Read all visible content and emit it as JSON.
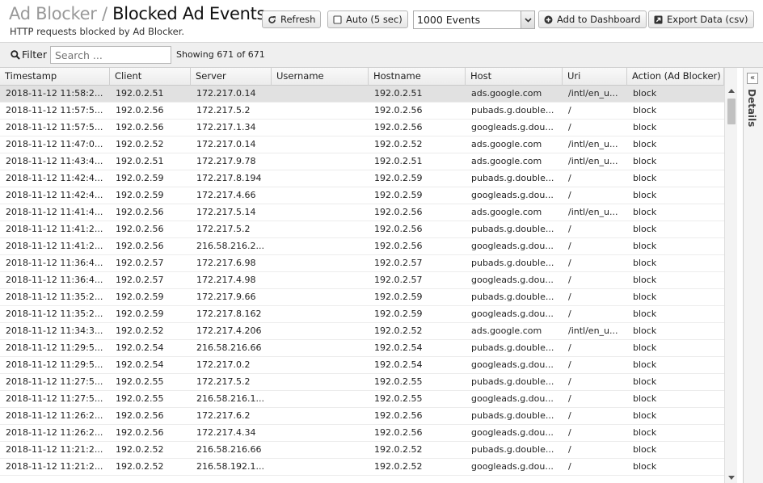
{
  "header": {
    "breadcrumb": "Ad Blocker",
    "separator": "/",
    "title": "Blocked Ad Events",
    "subtitle": "HTTP requests blocked by Ad Blocker."
  },
  "toolbar": {
    "refresh_label": "Refresh",
    "auto_label": "Auto (5 sec)",
    "auto_checked": false,
    "events_selected": "1000 Events",
    "add_dashboard_label": "Add to Dashboard",
    "export_label": "Export Data (csv)"
  },
  "filter": {
    "label": "Filter",
    "placeholder": "Search ...",
    "showing": "Showing 671 of 671"
  },
  "details": {
    "label": "Details",
    "collapse_glyph": "«"
  },
  "grid": {
    "columns": [
      "Timestamp",
      "Client",
      "Server",
      "Username",
      "Hostname",
      "Host",
      "Uri",
      "Action (Ad Blocker)"
    ],
    "rows": [
      [
        "2018-11-12 11:58:2...",
        "192.0.2.51",
        "172.217.0.14",
        "",
        "192.0.2.51",
        "ads.google.com",
        "/intl/en_u...",
        "block"
      ],
      [
        "2018-11-12 11:57:5...",
        "192.0.2.56",
        "172.217.5.2",
        "",
        "192.0.2.56",
        "pubads.g.double...",
        "/",
        "block"
      ],
      [
        "2018-11-12 11:57:5...",
        "192.0.2.56",
        "172.217.1.34",
        "",
        "192.0.2.56",
        "googleads.g.dou...",
        "/",
        "block"
      ],
      [
        "2018-11-12 11:47:0...",
        "192.0.2.52",
        "172.217.0.14",
        "",
        "192.0.2.52",
        "ads.google.com",
        "/intl/en_u...",
        "block"
      ],
      [
        "2018-11-12 11:43:4...",
        "192.0.2.51",
        "172.217.9.78",
        "",
        "192.0.2.51",
        "ads.google.com",
        "/intl/en_u...",
        "block"
      ],
      [
        "2018-11-12 11:42:4...",
        "192.0.2.59",
        "172.217.8.194",
        "",
        "192.0.2.59",
        "pubads.g.double...",
        "/",
        "block"
      ],
      [
        "2018-11-12 11:42:4...",
        "192.0.2.59",
        "172.217.4.66",
        "",
        "192.0.2.59",
        "googleads.g.dou...",
        "/",
        "block"
      ],
      [
        "2018-11-12 11:41:4...",
        "192.0.2.56",
        "172.217.5.14",
        "",
        "192.0.2.56",
        "ads.google.com",
        "/intl/en_u...",
        "block"
      ],
      [
        "2018-11-12 11:41:2...",
        "192.0.2.56",
        "172.217.5.2",
        "",
        "192.0.2.56",
        "pubads.g.double...",
        "/",
        "block"
      ],
      [
        "2018-11-12 11:41:2...",
        "192.0.2.56",
        "216.58.216.2...",
        "",
        "192.0.2.56",
        "googleads.g.dou...",
        "/",
        "block"
      ],
      [
        "2018-11-12 11:36:4...",
        "192.0.2.57",
        "172.217.6.98",
        "",
        "192.0.2.57",
        "pubads.g.double...",
        "/",
        "block"
      ],
      [
        "2018-11-12 11:36:4...",
        "192.0.2.57",
        "172.217.4.98",
        "",
        "192.0.2.57",
        "googleads.g.dou...",
        "/",
        "block"
      ],
      [
        "2018-11-12 11:35:2...",
        "192.0.2.59",
        "172.217.9.66",
        "",
        "192.0.2.59",
        "pubads.g.double...",
        "/",
        "block"
      ],
      [
        "2018-11-12 11:35:2...",
        "192.0.2.59",
        "172.217.8.162",
        "",
        "192.0.2.59",
        "googleads.g.dou...",
        "/",
        "block"
      ],
      [
        "2018-11-12 11:34:3...",
        "192.0.2.52",
        "172.217.4.206",
        "",
        "192.0.2.52",
        "ads.google.com",
        "/intl/en_u...",
        "block"
      ],
      [
        "2018-11-12 11:29:5...",
        "192.0.2.54",
        "216.58.216.66",
        "",
        "192.0.2.54",
        "pubads.g.double...",
        "/",
        "block"
      ],
      [
        "2018-11-12 11:29:5...",
        "192.0.2.54",
        "172.217.0.2",
        "",
        "192.0.2.54",
        "googleads.g.dou...",
        "/",
        "block"
      ],
      [
        "2018-11-12 11:27:5...",
        "192.0.2.55",
        "172.217.5.2",
        "",
        "192.0.2.55",
        "pubads.g.double...",
        "/",
        "block"
      ],
      [
        "2018-11-12 11:27:5...",
        "192.0.2.55",
        "216.58.216.1...",
        "",
        "192.0.2.55",
        "googleads.g.dou...",
        "/",
        "block"
      ],
      [
        "2018-11-12 11:26:2...",
        "192.0.2.56",
        "172.217.6.2",
        "",
        "192.0.2.56",
        "pubads.g.double...",
        "/",
        "block"
      ],
      [
        "2018-11-12 11:26:2...",
        "192.0.2.56",
        "172.217.4.34",
        "",
        "192.0.2.56",
        "googleads.g.dou...",
        "/",
        "block"
      ],
      [
        "2018-11-12 11:21:2...",
        "192.0.2.52",
        "216.58.216.66",
        "",
        "192.0.2.52",
        "pubads.g.double...",
        "/",
        "block"
      ],
      [
        "2018-11-12 11:21:2...",
        "192.0.2.52",
        "216.58.192.1...",
        "",
        "192.0.2.52",
        "googleads.g.dou...",
        "/",
        "block"
      ]
    ]
  }
}
